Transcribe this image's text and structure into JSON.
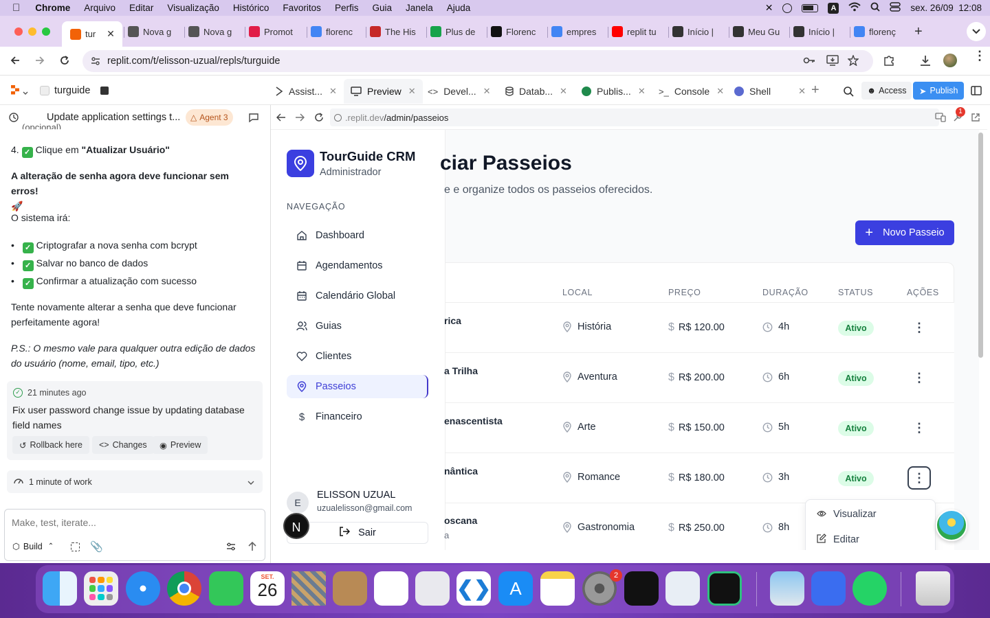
{
  "menubar": {
    "app": "Chrome",
    "items": [
      "Arquivo",
      "Editar",
      "Visualização",
      "Histórico",
      "Favoritos",
      "Perfis",
      "Guia",
      "Janela",
      "Ajuda"
    ],
    "clock": "sex. 26/09  12:08",
    "input_source": "A"
  },
  "tabs": [
    {
      "label": "tur",
      "color": "#f26207"
    },
    {
      "label": "Nova g",
      "color": "#555"
    },
    {
      "label": "Nova g",
      "color": "#555"
    },
    {
      "label": "Promot",
      "color": "#e11d48"
    },
    {
      "label": "florenc",
      "color": "#4285f4"
    },
    {
      "label": "The His",
      "color": "#c62828"
    },
    {
      "label": "Plus de",
      "color": "#16a34a"
    },
    {
      "label": "Florenc",
      "color": "#111"
    },
    {
      "label": "empres",
      "color": "#4285f4"
    },
    {
      "label": "replit tu",
      "color": "#ff0000"
    },
    {
      "label": "Início |",
      "color": "#333"
    },
    {
      "label": "Meu Gu",
      "color": "#333"
    },
    {
      "label": "Início |",
      "color": "#333"
    },
    {
      "label": "florenç",
      "color": "#4285f4"
    }
  ],
  "address": {
    "url": "replit.com/t/elisson-uzual/repls/turguide"
  },
  "replit": {
    "project": "turguide",
    "tabs": [
      "Assist...",
      "Preview",
      "Devel...",
      "Datab...",
      "Publis...",
      "Console",
      "Shell"
    ],
    "access": "Access",
    "publish": "Publish"
  },
  "agent": {
    "thread_title": "Update application settings t...",
    "agent_badge": "Agent 3",
    "cut_line": "(opcional)",
    "step4_num": "4.",
    "step4_pre": "Clique em ",
    "step4_bold": "\"Atualizar Usuário\"",
    "bold_line": "A alteração de senha agora deve funcionar sem erros!",
    "rocket": "🚀",
    "system_will": "O sistema irá:",
    "bullets": [
      "Criptografar a nova senha com bcrypt",
      "Salvar no banco de dados",
      "Confirmar a atualização com sucesso"
    ],
    "retry": "Tente novamente alterar a senha que deve funcionar perfeitamente agora!",
    "ps": "P.S.: O mesmo vale para qualquer outra edição de dados do usuário (nome, email, tipo, etc.)",
    "checkpoint_time": "21 minutes ago",
    "checkpoint_msg": "Fix user password change issue by updating database field names",
    "rollback": "Rollback here",
    "changes": "Changes",
    "preview": "Preview",
    "work": "1 minute of work",
    "input_placeholder": "Make, test, iterate...",
    "build": "Build"
  },
  "preview": {
    "url_prefix": ".replit.dev",
    "url_path": "/admin/passeios",
    "notif_count": "1"
  },
  "app": {
    "brand": "TourGuide CRM",
    "role": "Administrador",
    "nav_heading": "NAVEGAÇÃO",
    "nav": [
      "Dashboard",
      "Agendamentos",
      "Calendário Global",
      "Guias",
      "Clientes",
      "Passeios",
      "Financeiro"
    ],
    "user_initial": "E",
    "user_name": "ELISSON UZUAL",
    "user_email": "uzualelisson@gmail.com",
    "logout": "Sair",
    "page_title": "ciar Passeios",
    "page_subtitle": "e e organize todos os passeios oferecidos.",
    "new_button": "Novo Passeio",
    "columns": [
      "LOCAL",
      "PREÇO",
      "DURAÇÃO",
      "STATUS",
      "AÇÕES"
    ],
    "rows": [
      {
        "name": "rica",
        "sub": "",
        "local": "História",
        "price": "R$ 120.00",
        "duration": "4h",
        "status": "Ativo"
      },
      {
        "name": "a Trilha",
        "sub": "",
        "local": "Aventura",
        "price": "R$ 200.00",
        "duration": "6h",
        "status": "Ativo"
      },
      {
        "name": "enascentista",
        "sub": "",
        "local": "Arte",
        "price": "R$ 150.00",
        "duration": "5h",
        "status": "Ativo"
      },
      {
        "name": "nântica",
        "sub": "",
        "local": "Romance",
        "price": "R$ 180.00",
        "duration": "3h",
        "status": "Ativo"
      },
      {
        "name": "oscana",
        "sub": "a",
        "local": "Gastronomia",
        "price": "R$ 250.00",
        "duration": "8h",
        "status": ""
      }
    ],
    "menu": [
      "Visualizar",
      "Editar"
    ]
  },
  "dock": {
    "calendar_month": "SET.",
    "calendar_day": "26",
    "settings_badge": "2"
  }
}
